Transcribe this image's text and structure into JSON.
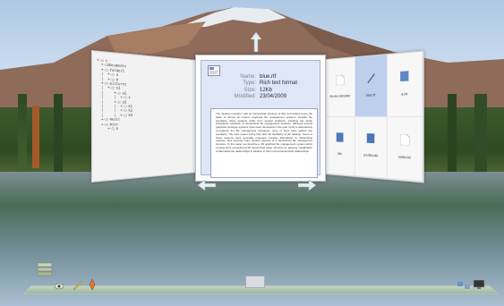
{
  "file_info": {
    "labels": {
      "name": "Name:",
      "type": "Type:",
      "size": "Size:",
      "modified": "Modified:"
    },
    "name": "blue.rtf",
    "type": "Rich text format",
    "size": "12Kb",
    "modified": "23/04/2009"
  },
  "preview_text": "The desktop metaphor with its hierarchical structure of files and folders forms the basis of almost all modern graphical file management systems. Despite the popularity, these systems suffer from several problems, including the single inheritance restriction of hierarchical file management structure. Although several graphical prototype systems have been developed in the past trying to alternatively re-organize the file management structures, none of them have gained any popularity. The main reason being they lack the familiarity of the desktop. Some of these systems have generally proposed complex alternatives to hierarchical systems, thus ignoring many positive aspects of a hierarchical file management structure. In this paper we describe a 3D graphical file management system which complements conventional 2D hierarchical folder structure by allowing visualization of alternative file relationships in addition to their normal hierarchical relationships.",
  "tree_text": "+-□ c\n  +-□documents\n  +-□ folder1\n  |  +-□ a\n  |  +-□ b\n  +-□ pictures\n  |  +-□ x1\n  |     +-□ y2\n  |     |  +-□ z\n  |     +-□ y3\n  |     |  +-□ k1\n  |     |  +-□ k2\n  |     |  +-□ k3\n  +-□ music\n  +-□ misc\n     +-□ p",
  "grid_files": [
    "file.doc.template",
    "blue.rtf",
    "a.txt",
    "info",
    "a.b.file.info",
    "notes.txt"
  ],
  "colors": {
    "selection": "#bcd0ee",
    "panel_bg": "#dfe6f6"
  }
}
